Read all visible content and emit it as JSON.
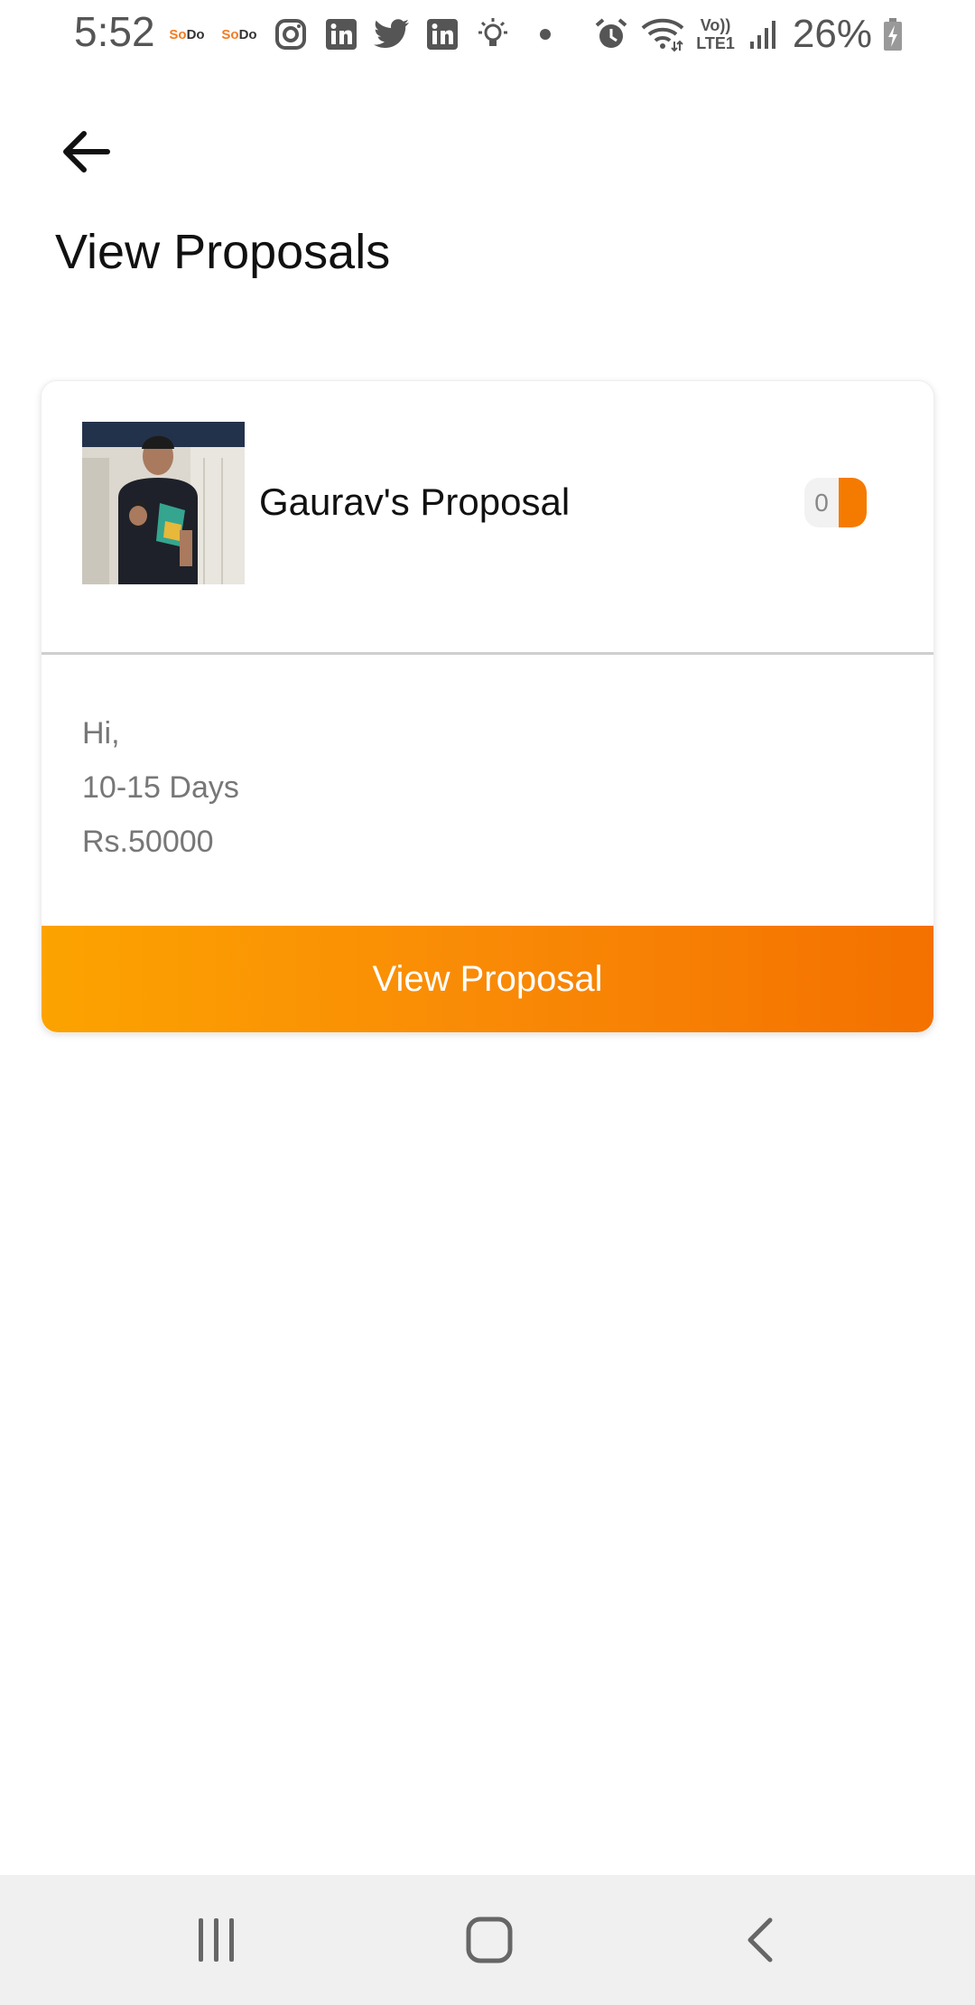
{
  "status_bar": {
    "time": "5:52",
    "battery": "26%",
    "sodo_label": "SoDo",
    "left_icons": [
      "sodo-icon",
      "sodo-icon",
      "instagram-icon",
      "linkedin-icon",
      "twitter-icon",
      "linkedin-icon",
      "bulb-icon",
      "dot-icon"
    ],
    "right_icons": [
      "alarm-icon",
      "wifi-icon",
      "volte-icon",
      "signal-icon",
      "battery-charging-icon"
    ],
    "volte_label": "Vo))",
    "lte_label": "LTE1"
  },
  "header": {
    "title": "View Proposals",
    "back_icon": "arrow-left-icon"
  },
  "proposal_card": {
    "name": "Gaurav's Proposal",
    "count": "0",
    "lines": [
      "Hi,",
      "10-15 Days",
      "Rs.50000"
    ],
    "button_label": "View Proposal",
    "accent_start": "#fca300",
    "accent_end": "#f47100"
  },
  "nav_bar": {
    "items": [
      "recent-apps-icon",
      "home-icon",
      "back-icon"
    ]
  }
}
